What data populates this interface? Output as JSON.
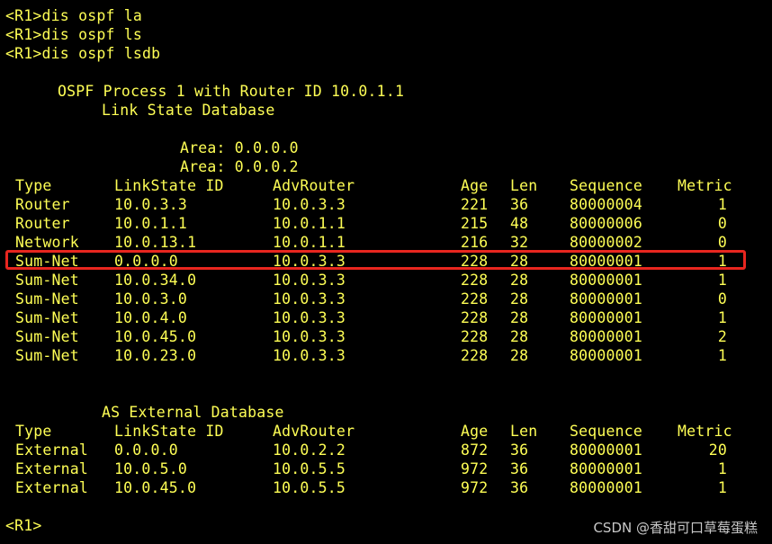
{
  "commands": [
    "<R1>dis ospf la",
    "<R1>dis ospf ls",
    "<R1>dis ospf lsdb"
  ],
  "header": {
    "process_line": "OSPF Process 1 with Router ID 10.0.1.1",
    "db_title": "Link State Database"
  },
  "areas": [
    "Area: 0.0.0.0",
    "Area: 0.0.0.2"
  ],
  "columns": [
    "Type",
    "LinkState ID",
    "AdvRouter",
    "Age",
    "Len",
    "Sequence",
    "Metric"
  ],
  "lsdb_rows": [
    [
      "Router",
      "10.0.3.3",
      "10.0.3.3",
      "221",
      "36",
      "80000004",
      "1"
    ],
    [
      "Router",
      "10.0.1.1",
      "10.0.1.1",
      "215",
      "48",
      "80000006",
      "0"
    ],
    [
      "Network",
      "10.0.13.1",
      "10.0.1.1",
      "216",
      "32",
      "80000002",
      "0"
    ],
    [
      "Sum-Net",
      "0.0.0.0",
      "10.0.3.3",
      "228",
      "28",
      "80000001",
      "1"
    ],
    [
      "Sum-Net",
      "10.0.34.0",
      "10.0.3.3",
      "228",
      "28",
      "80000001",
      "1"
    ],
    [
      "Sum-Net",
      "10.0.3.0",
      "10.0.3.3",
      "228",
      "28",
      "80000001",
      "0"
    ],
    [
      "Sum-Net",
      "10.0.4.0",
      "10.0.3.3",
      "228",
      "28",
      "80000001",
      "1"
    ],
    [
      "Sum-Net",
      "10.0.45.0",
      "10.0.3.3",
      "228",
      "28",
      "80000001",
      "2"
    ],
    [
      "Sum-Net",
      "10.0.23.0",
      "10.0.3.3",
      "228",
      "28",
      "80000001",
      "1"
    ]
  ],
  "external": {
    "title": "AS External Database",
    "rows": [
      [
        "External",
        "0.0.0.0",
        "10.0.2.2",
        "872",
        "36",
        "80000001",
        "20"
      ],
      [
        "External",
        "10.0.5.0",
        "10.0.5.5",
        "972",
        "36",
        "80000001",
        "1"
      ],
      [
        "External",
        "10.0.45.0",
        "10.0.5.5",
        "972",
        "36",
        "80000001",
        "1"
      ]
    ]
  },
  "prompt": "<R1>",
  "watermark": "CSDN @香甜可口草莓蛋糕",
  "colors": {
    "background": "#000000",
    "text": "#FFFF55",
    "highlight": "#E8261F"
  }
}
